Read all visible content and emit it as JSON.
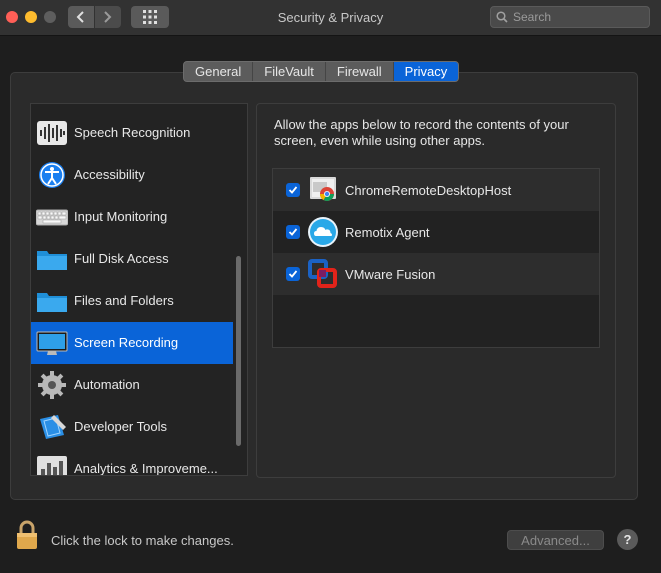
{
  "window": {
    "title": "Security & Privacy"
  },
  "search": {
    "placeholder": "Search"
  },
  "tabs": [
    {
      "label": "General",
      "active": false
    },
    {
      "label": "FileVault",
      "active": false
    },
    {
      "label": "Firewall",
      "active": false
    },
    {
      "label": "Privacy",
      "active": true
    }
  ],
  "sidebar": {
    "items": [
      {
        "label": "Speech Recognition",
        "icon": "waveform-icon"
      },
      {
        "label": "Accessibility",
        "icon": "accessibility-icon"
      },
      {
        "label": "Input Monitoring",
        "icon": "keyboard-icon"
      },
      {
        "label": "Full Disk Access",
        "icon": "folder-icon"
      },
      {
        "label": "Files and Folders",
        "icon": "folder-icon"
      },
      {
        "label": "Screen Recording",
        "icon": "monitor-icon",
        "selected": true
      },
      {
        "label": "Automation",
        "icon": "gear-icon"
      },
      {
        "label": "Developer Tools",
        "icon": "developer-tools-icon"
      },
      {
        "label": "Analytics & Improveme...",
        "icon": "analytics-icon"
      }
    ]
  },
  "main": {
    "description": "Allow the apps below to record the contents of your screen, even while using other apps.",
    "apps": [
      {
        "label": "ChromeRemoteDesktopHost",
        "checked": true,
        "icon": "chrome-remote-desktop-icon"
      },
      {
        "label": "Remotix Agent",
        "checked": true,
        "icon": "remotix-cloud-icon"
      },
      {
        "label": "VMware Fusion",
        "checked": true,
        "icon": "vmware-fusion-icon"
      }
    ]
  },
  "footer": {
    "lock_text": "Click the lock to make changes.",
    "advanced_label": "Advanced...",
    "help_label": "?"
  },
  "colors": {
    "accent": "#0a64d8",
    "window_bg": "#1e1e1e",
    "panel_bg": "#2b2b2b"
  }
}
